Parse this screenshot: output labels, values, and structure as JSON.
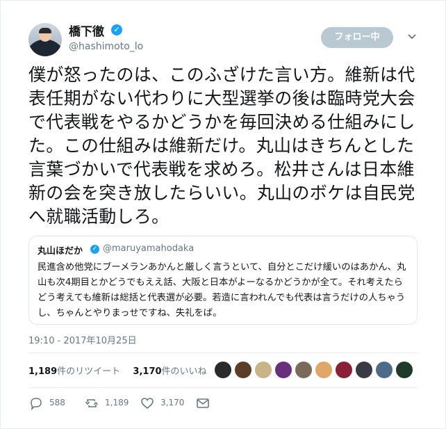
{
  "user": {
    "display_name": "橋下徹",
    "handle": "@hashimoto_lo",
    "verified_glyph": "✓"
  },
  "follow_button": {
    "label": "フォロー中"
  },
  "menu_caret": "⌄",
  "tweet": {
    "text": "僕が怒ったのは、このふざけた言い方。維新は代表任期がない代わりに大型選挙の後は臨時党大会で代表戦をやるかどうかを毎回決める仕組みにした。この仕組みは維新だけ。丸山はきちんとした言葉づかいで代表戦を求めろ。松井さんは日本維新の会を突き放したらいい。丸山のボケは自民党へ就職活動しろ。",
    "timestamp": "19:10 - 2017年10月25日"
  },
  "quoted": {
    "display_name": "丸山ほだか",
    "handle": "@maruyamahodaka",
    "text": "民進含め他党にブーメランあかんと厳しく言うといて、自分とこだけ緩いのはあかん、丸山も次4期目とかどうでもええ話、大阪と日本がよーなるかどうかが全て。それ考えたらどう考えても維新は総括と代表選が必要。若造に言われんでも代表は言うだけの人ちゃうし、ちゃんとやりまっせですね、失礼をば。"
  },
  "stats": {
    "retweets": "1,189",
    "retweets_label": "件のリツイート",
    "likes": "3,170",
    "likes_label": "件のいいね"
  },
  "actions": {
    "reply_count": "588",
    "retweet_count": "1,189",
    "like_count": "3,170"
  },
  "colors": {
    "accent": "#1da1f2",
    "follow_button_bg": "#b9c9d4",
    "muted_text": "#657786"
  },
  "likers": [
    {
      "name": "liker-avatar-1",
      "color": "#2a2a2a"
    },
    {
      "name": "liker-avatar-2",
      "color": "#5b3d2a"
    },
    {
      "name": "liker-avatar-3",
      "color": "#c9b48a"
    },
    {
      "name": "liker-avatar-4",
      "color": "#6a2f7a"
    },
    {
      "name": "liker-avatar-5",
      "color": "#7a6a5a"
    },
    {
      "name": "liker-avatar-6",
      "color": "#e0a868"
    },
    {
      "name": "liker-avatar-7",
      "color": "#8a2038"
    },
    {
      "name": "liker-avatar-8",
      "color": "#3a3a44"
    },
    {
      "name": "liker-avatar-9",
      "color": "#4c6a8a"
    },
    {
      "name": "liker-avatar-10",
      "color": "#1f3a2a"
    }
  ]
}
